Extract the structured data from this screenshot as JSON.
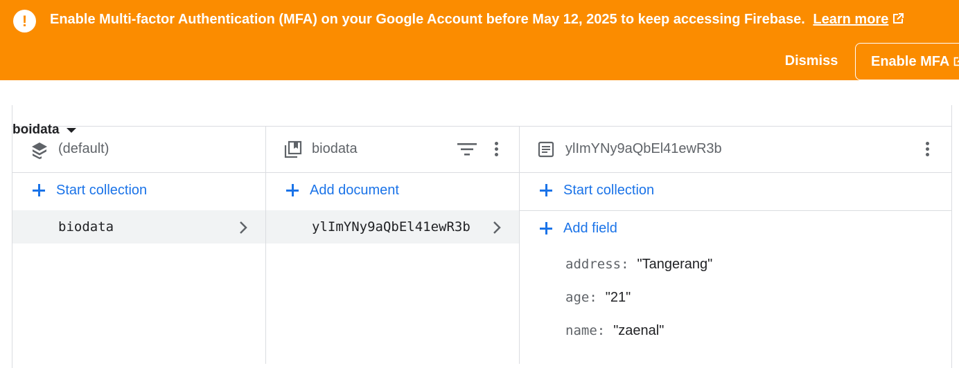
{
  "banner": {
    "message": "Enable Multi-factor Authentication (MFA) on your Google Account before May 12, 2025 to keep accessing Firebase.",
    "learn_more": "Learn more",
    "dismiss": "Dismiss",
    "enable": "Enable MFA",
    "bg_color": "#fb8c00"
  },
  "database_selector": "boidata",
  "columns": {
    "root": {
      "label": "(default)",
      "action": "Start collection",
      "items": [
        "biodata"
      ]
    },
    "collection": {
      "label": "biodata",
      "action": "Add document",
      "items": [
        "ylImYNy9aQbEl41ewR3b"
      ]
    },
    "document": {
      "label": "ylImYNy9aQbEl41ewR3b",
      "action_collection": "Start collection",
      "action_field": "Add field",
      "fields": [
        {
          "key": "address:",
          "value": "\"Tangerang\""
        },
        {
          "key": "age:",
          "value": "\"21\""
        },
        {
          "key": "name:",
          "value": "\"zaenal\""
        }
      ]
    }
  },
  "colors": {
    "accent": "#1a73e8",
    "muted": "#5f6368",
    "selected_bg": "#f1f3f4"
  }
}
